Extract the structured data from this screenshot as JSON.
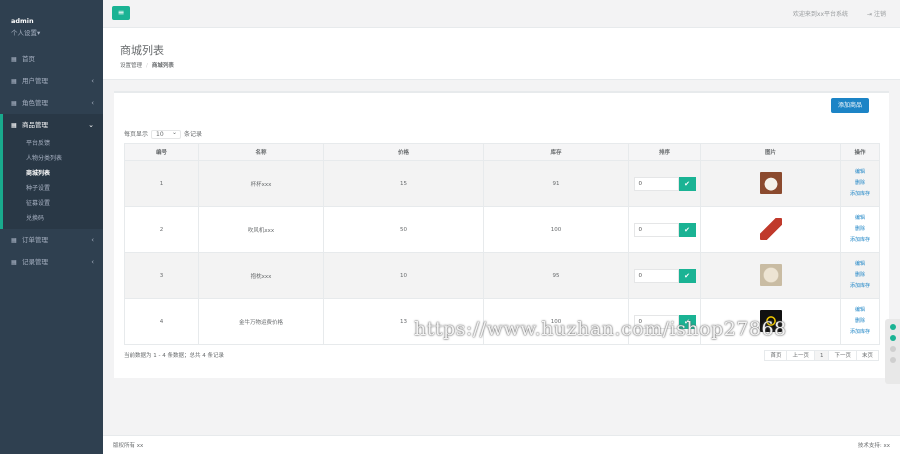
{
  "sidebar": {
    "user": "admin",
    "settings": "个人设置▾",
    "items": [
      {
        "label": "首页",
        "chevron": ""
      },
      {
        "label": "用户管理",
        "chevron": "‹"
      },
      {
        "label": "角色管理",
        "chevron": "‹"
      },
      {
        "label": "商品管理",
        "chevron": "⌄"
      },
      {
        "label": "订单管理",
        "chevron": "‹"
      },
      {
        "label": "记录管理",
        "chevron": "‹"
      }
    ],
    "subitems": [
      "平台反馈",
      "人物分类列表",
      "商城列表",
      "种子设置",
      "征募设置",
      "兑换码"
    ]
  },
  "topbar": {
    "welcome": "欢迎来到xx平台系统",
    "logout": "注销"
  },
  "heading": {
    "title": "商城列表",
    "crumb1": "设置管理",
    "crumb2": "商城列表"
  },
  "panel": {
    "add_button": "添加商品",
    "length_prefix": "每页显示",
    "length_value": "10",
    "length_suffix": "条记录",
    "columns": [
      "编号",
      "名称",
      "价格",
      "库存",
      "排序",
      "图片",
      "操作"
    ],
    "rows": [
      {
        "id": "1",
        "name": "杯杯xxx",
        "price": "15",
        "stock": "91",
        "sort": "0",
        "img_color": "#8b4a2e"
      },
      {
        "id": "2",
        "name": "吹风机xxx",
        "price": "50",
        "stock": "100",
        "sort": "0",
        "img_color": "#c0392b"
      },
      {
        "id": "3",
        "name": "抱枕xxx",
        "price": "10",
        "stock": "95",
        "sort": "0",
        "img_color": "#c9bca3"
      },
      {
        "id": "4",
        "name": "金牛万物运费价格",
        "price": "13",
        "stock": "100",
        "sort": "0",
        "img_color": "#111111"
      }
    ],
    "ops": [
      "编辑",
      "删除",
      "添加库存"
    ],
    "info": "当前数据为 1 - 4 条数据；总共 4 条记录",
    "pager": [
      "首页",
      "上一页",
      "1",
      "下一页",
      "末页"
    ]
  },
  "footer": {
    "left": "版权所有 xx",
    "right": "技术支持: xx"
  },
  "watermark": "https://www.huzhan.com/ishop27868",
  "colors": {
    "sidebar": "#2f4050",
    "accent": "#1ab394",
    "primary": "#1c84c6"
  }
}
